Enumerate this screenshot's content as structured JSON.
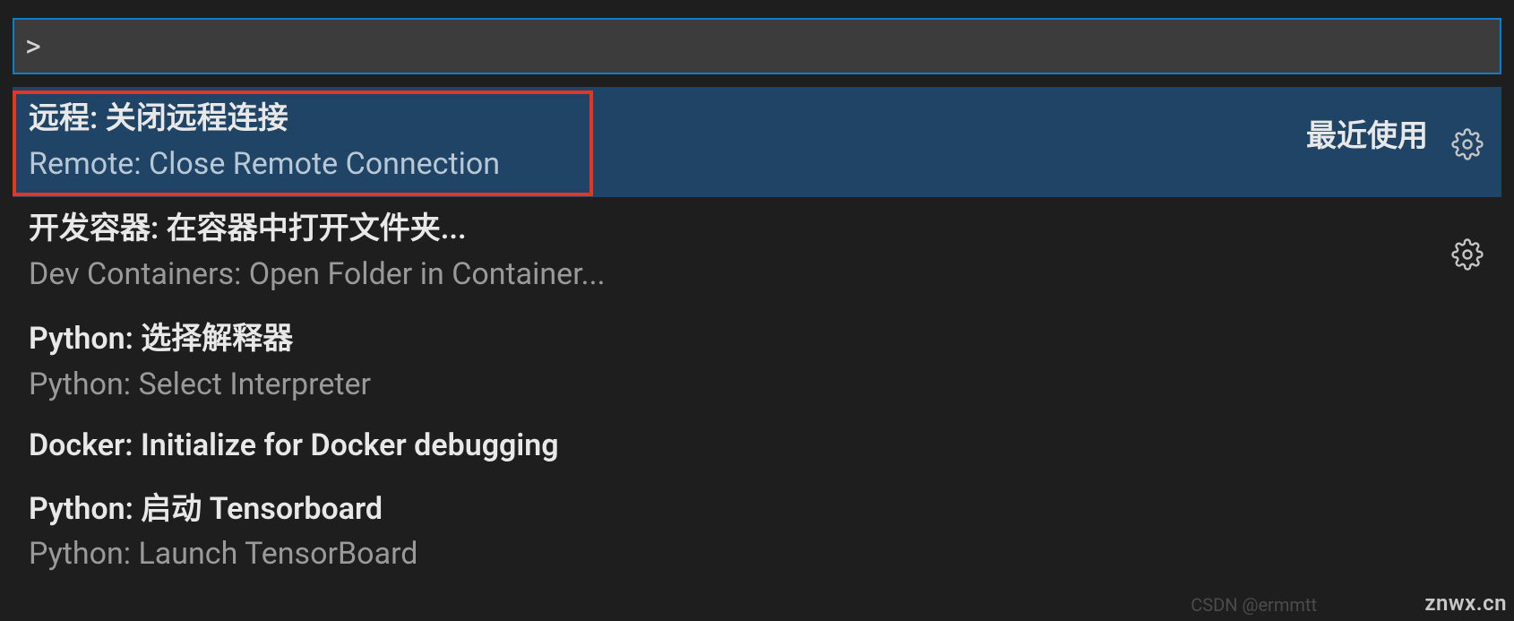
{
  "input": {
    "prefix": ">",
    "value": ""
  },
  "category_label": "最近使用",
  "items": [
    {
      "title": "远程: 关闭远程连接",
      "subtitle": "Remote: Close Remote Connection",
      "selected": true,
      "has_gear": true,
      "show_category": true
    },
    {
      "title": "开发容器: 在容器中打开文件夹...",
      "subtitle": "Dev Containers: Open Folder in Container...",
      "selected": false,
      "has_gear": true,
      "show_category": false
    },
    {
      "title": "Python: 选择解释器",
      "subtitle": "Python: Select Interpreter",
      "selected": false,
      "has_gear": false,
      "show_category": false
    },
    {
      "title": "Docker: Initialize for Docker debugging",
      "subtitle": "",
      "selected": false,
      "has_gear": false,
      "show_category": false
    },
    {
      "title": "Python: 启动 Tensorboard",
      "subtitle": "Python: Launch TensorBoard",
      "selected": false,
      "has_gear": false,
      "show_category": false
    }
  ],
  "watermarks": {
    "right": "znwx.cn",
    "center": "CSDN @ermmtt"
  }
}
